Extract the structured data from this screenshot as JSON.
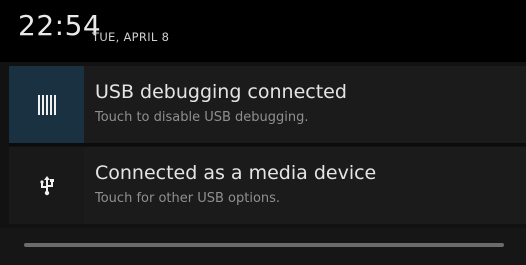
{
  "status": {
    "time": "22:54",
    "date": "TUE, APRIL 8"
  },
  "notifications": [
    {
      "icon": "usb-debug-bars-icon",
      "title": "USB debugging connected",
      "subtitle": "Touch to disable USB debugging.",
      "icon_bg": "#193140"
    },
    {
      "icon": "usb-trident-icon",
      "title": "Connected as a media device",
      "subtitle": "Touch for other USB options.",
      "icon_bg": "#191919"
    }
  ],
  "colors": {
    "header_bg": "#000000",
    "panel_bg": "#1b1b1b",
    "title_text": "#e4e4e4",
    "subtitle_text": "#8f8f8f",
    "handle": "#6b6b6b"
  }
}
